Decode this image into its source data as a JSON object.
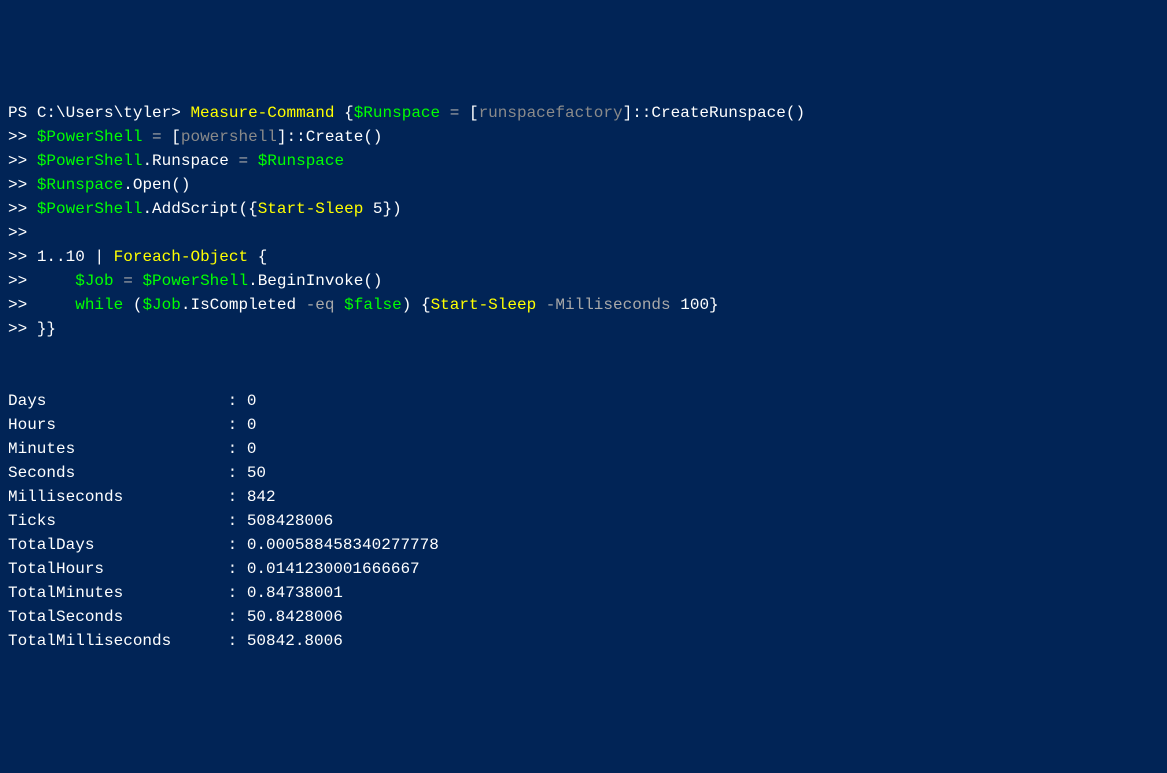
{
  "prompt": {
    "ps": "PS ",
    "path": "C:\\Users\\tyler>",
    "cont": ">>"
  },
  "code": {
    "measure_command": "Measure-Command",
    "lbrace": "{",
    "rbrace": "}",
    "runspace_var": "$Runspace",
    "powershell_var": "$PowerShell",
    "job_var": "$Job",
    "false_var": "$false",
    "eq_op": "=",
    "runspacefactory": "runspacefactory",
    "create_runspace": "CreateRunspace",
    "powershell_type": "powershell",
    "create": "Create",
    "runspace_prop": "Runspace",
    "open": "Open",
    "addscript": "AddScript",
    "start_sleep": "Start-Sleep",
    "sleep_arg": "5",
    "range_start": "1",
    "range_dots": "..",
    "range_end": "10",
    "pipe": "|",
    "foreach_object": "Foreach-Object",
    "begin_invoke": "BeginInvoke",
    "while_kw": "while",
    "iscompleted": "IsCompleted",
    "eq_cmp": "-eq",
    "milliseconds_param": "-Milliseconds",
    "ms_val": "100",
    "lbracket": "[",
    "rbracket": "]",
    "dcolon": "::",
    "lparen": "(",
    "rparen": ")",
    "dot": "."
  },
  "output": {
    "Days": "0",
    "Hours": "0",
    "Minutes": "0",
    "Seconds": "50",
    "Milliseconds": "842",
    "Ticks": "508428006",
    "TotalDays": "0.000588458340277778",
    "TotalHours": "0.0141230001666667",
    "TotalMinutes": "0.84738001",
    "TotalSeconds": "50.8428006",
    "TotalMilliseconds": "50842.8006"
  },
  "output_keys": {
    "Days": "Days",
    "Hours": "Hours",
    "Minutes": "Minutes",
    "Seconds": "Seconds",
    "Milliseconds": "Milliseconds",
    "Ticks": "Ticks",
    "TotalDays": "TotalDays",
    "TotalHours": "TotalHours",
    "TotalMinutes": "TotalMinutes",
    "TotalSeconds": "TotalSeconds",
    "TotalMilliseconds": "TotalMilliseconds"
  },
  "sep": " : "
}
